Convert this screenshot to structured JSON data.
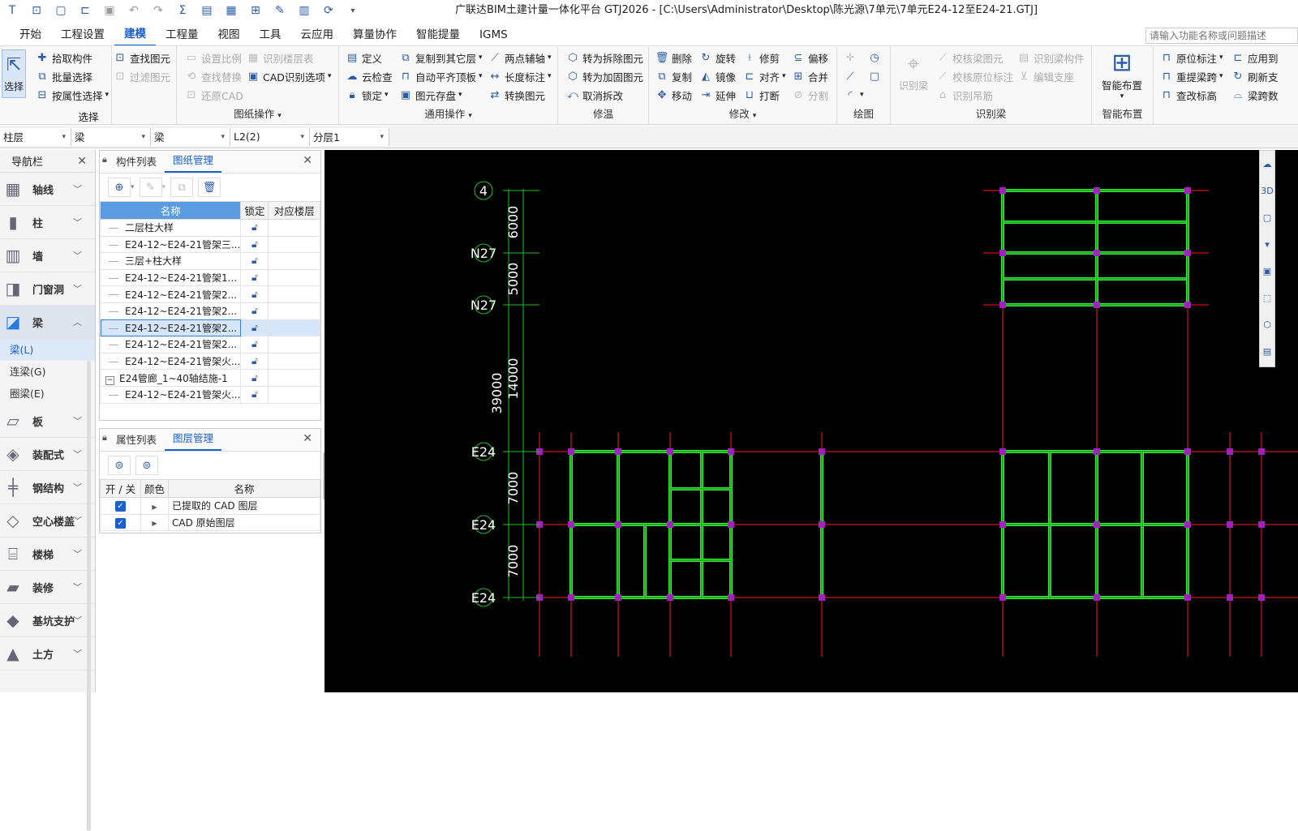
{
  "window": {
    "title": "广联达BIM土建计量一体化平台 GTJ2026 - [C:\\Users\\Administrator\\Desktop\\陈光源\\7单元\\7单元E24-12至E24-21.GTJ]"
  },
  "menu": {
    "items": [
      "开始",
      "工程设置",
      "建模",
      "工程量",
      "视图",
      "工具",
      "云应用",
      "算量协作",
      "智能提量",
      "IGMS"
    ],
    "active": "建模",
    "search_placeholder": "请输入功能名称或问题描述"
  },
  "ribbon": {
    "select_group": {
      "label": "选择",
      "select": "选择",
      "pick": "拾取构件",
      "batch": "批量选择",
      "by_attr": "按属性选择",
      "find": "查找图元",
      "filter": "过滤图元"
    },
    "drawing_ops": {
      "label": "图纸操作",
      "set_scale": "设置比例",
      "find_replace": "查找替换",
      "restore_cad": "还原CAD",
      "recognize_floor": "识别楼层表",
      "cad_options": "CAD识别选项"
    },
    "common_ops": {
      "label": "通用操作",
      "define": "定义",
      "cloud_check": "云检查",
      "lock": "锁定",
      "copy_floor": "复制到其它层",
      "auto_align": "自动平齐顶板",
      "save_elem": "图元存盘",
      "two_point_axis": "两点辅轴",
      "length_dim": "长度标注",
      "convert": "转换图元"
    },
    "repair": {
      "label": "修温",
      "to_demolish": "转为拆除图元",
      "to_reinforce": "转为加固图元",
      "cancel_demolish": "取消拆改"
    },
    "modify": {
      "label": "修改",
      "delete": "删除",
      "copy": "复制",
      "move": "移动",
      "rotate": "旋转",
      "mirror": "镜像",
      "extend": "延伸",
      "trim": "修剪",
      "align": "对齐",
      "break": "打断",
      "offset": "偏移",
      "merge": "合并",
      "split": "分割"
    },
    "draw": {
      "label": "绘图"
    },
    "recognize_beam": {
      "label": "识别梁",
      "recognize": "识别梁",
      "check_beam": "校核梁图元",
      "check_origin": "校核原位标注",
      "recognize_hanger": "识别吊筋",
      "recognize_comp": "识别梁构件",
      "edit_support": "编辑支座"
    },
    "smart_layout": {
      "label": "智能布置",
      "button": "智能布置"
    },
    "beam_dim": {
      "origin_dim": "原位标注",
      "re_extract": "重提梁跨",
      "check_height": "查改标高",
      "apply_to": "应用到",
      "refresh": "刷新支",
      "beam_count": "梁跨数"
    }
  },
  "filters": [
    {
      "label": "柱层",
      "caret": "▾"
    },
    {
      "label": "梁",
      "caret": "▾"
    },
    {
      "label": "梁",
      "caret": "▾"
    },
    {
      "label": "L2(2)",
      "caret": "▾"
    },
    {
      "label": "分层1",
      "caret": "▾"
    }
  ],
  "nav": {
    "title": "导航栏",
    "items": [
      {
        "label": "轴线",
        "icon": "axis-icon"
      },
      {
        "label": "柱",
        "icon": "column-icon"
      },
      {
        "label": "墙",
        "icon": "wall-icon"
      },
      {
        "label": "门窗洞",
        "icon": "door-window-icon"
      },
      {
        "label": "梁",
        "icon": "beam-icon",
        "open": true
      },
      {
        "label": "板",
        "icon": "slab-icon"
      },
      {
        "label": "装配式",
        "icon": "prefab-icon"
      },
      {
        "label": "钢结构",
        "icon": "steel-icon"
      },
      {
        "label": "空心楼盖",
        "icon": "hollow-floor-icon"
      },
      {
        "label": "楼梯",
        "icon": "stair-icon"
      },
      {
        "label": "装修",
        "icon": "decoration-icon"
      },
      {
        "label": "基坑支护",
        "icon": "pit-support-icon"
      },
      {
        "label": "土方",
        "icon": "earthwork-icon"
      }
    ],
    "beam_sub": [
      "梁(L)",
      "连梁(G)",
      "圈梁(E)"
    ]
  },
  "drawings_panel": {
    "tabs": [
      "构件列表",
      "图纸管理"
    ],
    "active_tab": "图纸管理",
    "columns": [
      "名称",
      "锁定",
      "对应楼层"
    ],
    "rows": [
      {
        "name": "二层柱大样",
        "indent": 1
      },
      {
        "name": "E24-12~E24-21管架三...",
        "indent": 1
      },
      {
        "name": "三层+柱大样",
        "indent": 1
      },
      {
        "name": "E24-12~E24-21管架1...",
        "indent": 1
      },
      {
        "name": "E24-12~E24-21管架2...",
        "indent": 1
      },
      {
        "name": "E24-12~E24-21管架2...",
        "indent": 1
      },
      {
        "name": "E24-12~E24-21管架2...",
        "indent": 1,
        "selected": true
      },
      {
        "name": "E24-12~E24-21管架2...",
        "indent": 1
      },
      {
        "name": "E24-12~E24-21管架火...",
        "indent": 1
      },
      {
        "name": "E24管廊_1~40轴结施-1",
        "indent": 0,
        "toggle": "−"
      },
      {
        "name": "E24-12~E24-21管架火...",
        "indent": 1
      }
    ]
  },
  "layers_panel": {
    "tabs": [
      "属性列表",
      "图层管理"
    ],
    "active_tab": "图层管理",
    "columns": [
      "开 / 关",
      "颜色",
      "名称"
    ],
    "rows": [
      {
        "on": true,
        "name": "已提取的 CAD 图层"
      },
      {
        "on": true,
        "name": "CAD 原始图层"
      }
    ]
  },
  "cad": {
    "axis_labels": [
      "4",
      "N27",
      "N27",
      "E24",
      "E24",
      "E24"
    ],
    "dimensions": [
      "6000",
      "5000",
      "14000",
      "39000",
      "7000",
      "7000"
    ],
    "colors": {
      "axis": "#ff2020",
      "beam": "#33ee33",
      "node": "#a020c0",
      "dim": "#20c020",
      "text": "#ffffff"
    }
  },
  "colors": {
    "accent": "#1a5fd0",
    "ribbon_bg": "#f8f8f8",
    "canvas_bg": "#000000"
  }
}
